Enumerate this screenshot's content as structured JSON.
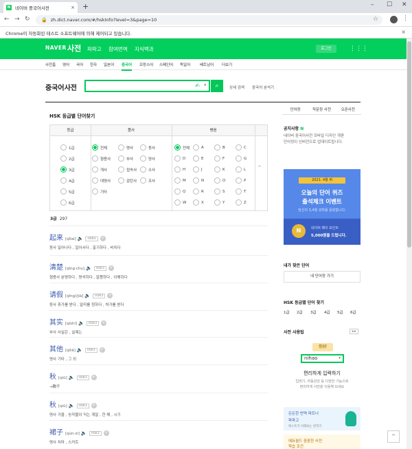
{
  "browser": {
    "tab_title": "네이버 중국어사전",
    "tab_close": "×",
    "new_tab": "+",
    "url": "zh.dict.naver.com/#/hskInfo?level=3&page=10",
    "infobar_text": "Chrome이 자동화된 테스트 소프트웨어에 의해 제어되고 있습니다.",
    "infobar_close": "×",
    "back": "←",
    "forward": "→",
    "reload": "↻",
    "min": "–",
    "max": "☐",
    "close": "✕",
    "star": "☆",
    "menu": "⋮"
  },
  "gnb": {
    "logo": "NAVER",
    "service": "사전",
    "links": [
      "파파고",
      "참여번역",
      "지식백과"
    ],
    "login": "로그인",
    "apps": "⋮⋮⋮"
  },
  "lang_nav": [
    "사전홈",
    "영어",
    "국어",
    "한자",
    "일본어",
    "중국어",
    "프랑스어",
    "스페인어",
    "독일어",
    "베트남어",
    "더보기"
  ],
  "lang_active_index": 5,
  "search": {
    "title": "중국어사전",
    "value": "",
    "handwriting": "✍",
    "dropdown": "▾",
    "button": "⌕",
    "links": [
      "상세 검색",
      "중국어 분석기"
    ]
  },
  "hsk": {
    "title": "HSK 등급별 단어찾기",
    "col_grade": "등급",
    "col_pos": "품사",
    "col_pinyin": "병음",
    "grades": [
      "1급",
      "2급",
      "3급",
      "4급",
      "5급",
      "6급"
    ],
    "grade_selected": 2,
    "pos": [
      "전체",
      "명사",
      "동사",
      "형용사",
      "부사",
      "양사",
      "개사",
      "접속사",
      "수사",
      "대명사",
      "감탄사",
      "조사",
      "기타"
    ],
    "pos_selected": 0,
    "pinyin": [
      "전체",
      "A",
      "B",
      "C",
      "D",
      "E",
      "F",
      "G",
      "H",
      "J",
      "K",
      "L",
      "M",
      "N",
      "O",
      "P",
      "Q",
      "R",
      "S",
      "T",
      "W",
      "X",
      "Y",
      "Z"
    ],
    "pinyin_selected": 0,
    "collapse_icon": "^",
    "result_level": "3급",
    "result_count": "297"
  },
  "entries": [
    {
      "word": "起来",
      "pinyin": "[qǐlai]",
      "badge": "HSK3",
      "def": "동사 일어나다 , 일어서다 , 흥기하다 , 비치다"
    },
    {
      "word": "清楚",
      "pinyin": "[qīng·chu]",
      "badge": "HSK3",
      "def": "형용사 분명하다 , 명석하다 , 알쯤하다 , 이해하다"
    },
    {
      "word": "请假",
      "pinyin": "[qǐng//jià]",
      "badge": "HSK3",
      "def": "동사 휴가를 받다 , 말미를 청하다 , 허가를 받다"
    },
    {
      "word": "其实",
      "pinyin": "[qíshí]",
      "badge": "HSK3",
      "def": "부사 사실은 , 실제는"
    },
    {
      "word": "其他",
      "pinyin": "[qítā]",
      "badge": "HSK3",
      "def": "명사 기타 , 그 외"
    },
    {
      "word": "秋",
      "pinyin": "[qiū]",
      "badge": "HSK3",
      "def": "→鞦千"
    },
    {
      "word": "秋",
      "pinyin": "[qiū]",
      "badge": "HSK3",
      "def": "명사 가을 , 농작물이 익는 계절 , 한 해 , 시기"
    },
    {
      "word": "裙子",
      "pinyin": "[qún·zi]",
      "badge": "HSK3",
      "def": "명사 치마 , 스커트"
    }
  ],
  "sidebar": {
    "tabs": [
      "단어장",
      "작문장 사전",
      "오픈사전"
    ],
    "notice_title": "공지사항",
    "notice_new": "N",
    "notice_text": [
      "네이버 중국어사전 모바일 디자인 개편",
      "단어정이 신버전으로 업데이트됩니다."
    ],
    "banner": {
      "date": "2021. 4월 퀴",
      "line1": "오늘의 단어 퀴즈",
      "line2": "출석체크 이벤트",
      "line3": "당신의 3,4월 성취를 응원합니다.",
      "coin": "N",
      "pay1": "네이버 페이 포인트",
      "pay2": "5,000원을 드립니다."
    },
    "my_words_title": "내가 찾은 단어",
    "my_words_button": "내 단어장 가기",
    "hsk_title": "HSK 등급별 단어 찾기",
    "hsk_levels": [
      "1급",
      "2급",
      "3급",
      "4급",
      "5급",
      "6급"
    ],
    "guide_title": "사전 사용팁",
    "guide_arrows": "◂ ▸",
    "guide_tip": "你好",
    "guide_input": "nihao",
    "guide_dd": "▾",
    "guide_head": "편리하게 입력하기",
    "guide_desc": [
      "입력기, 자동완성 등 다양한 기능으로",
      "편리하게 사전을 이용해 보세요"
    ],
    "promo1": {
      "a": "든든한 번역 파트너",
      "b": "파파고",
      "c": "텍스트가 이해되는 번역기"
    },
    "promo2": {
      "a": "에듀월드 중중한 사전",
      "b": "학습 조건"
    }
  },
  "totop": "^"
}
